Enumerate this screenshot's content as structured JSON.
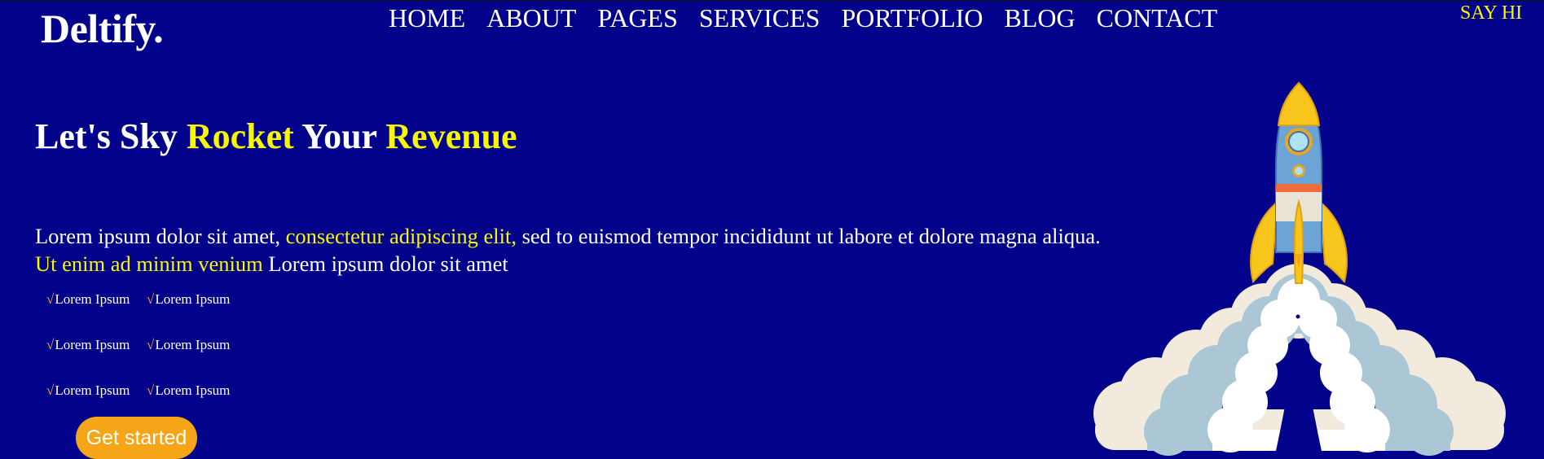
{
  "brand": {
    "logo": "Deltify."
  },
  "nav": {
    "items": [
      "HOME",
      "ABOUT",
      "PAGES",
      "SERVICES",
      "PORTFOLIO",
      "BLOG",
      "CONTACT"
    ],
    "cta": "SAY HI"
  },
  "hero": {
    "headline": {
      "part1": "Let's Sky ",
      "part2": "Rocket",
      "part3": " Your ",
      "part4": "Revenue"
    },
    "paragraph": {
      "p1": "Lorem ipsum dolor sit amet, ",
      "p2": "consectetur adipiscing elit,",
      "p3": " sed to euismod tempor incididunt ut labore et dolore magna aliqua. ",
      "p4": "Ut enim ad minim venium",
      "p5": " Lorem ipsum dolor sit amet"
    },
    "check_symbol": "√",
    "features": [
      [
        "Lorem Ipsum",
        "Lorem Ipsum"
      ],
      [
        "Lorem Ipsum",
        "Lorem Ipsum"
      ],
      [
        "Lorem Ipsum",
        "Lorem Ipsum"
      ]
    ],
    "button": "Get started"
  },
  "colors": {
    "background": "#02028b",
    "accent_yellow": "#f7f700",
    "button_orange": "#f5a517"
  },
  "illustration": {
    "icon": "rocket-launch-illustration"
  }
}
